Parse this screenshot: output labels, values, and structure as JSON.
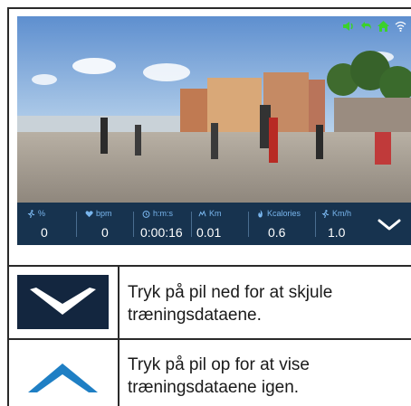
{
  "metrics": [
    {
      "icon": "runner-icon",
      "unit": "%",
      "value": "0"
    },
    {
      "icon": "heart-icon",
      "unit": "bpm",
      "value": "0"
    },
    {
      "icon": "clock-icon",
      "unit": "h:m:s",
      "value": "0:00:16"
    },
    {
      "icon": "distance-icon",
      "unit": "Km",
      "value": "0.01"
    },
    {
      "icon": "flame-icon",
      "unit": "Kcalories",
      "value": "0.6"
    },
    {
      "icon": "runner-icon",
      "unit": "Km/h",
      "value": "1.0"
    }
  ],
  "status_icons": [
    "speaker-icon",
    "back-icon",
    "home-icon",
    "wifi-icon"
  ],
  "rows": [
    {
      "icon": "chevron-down-icon",
      "text_line1": "Tryk på pil ned for at skjule",
      "text_line2": "træningsdataene."
    },
    {
      "icon": "chevron-up-icon",
      "text_line1": "Tryk på pil op for at vise",
      "text_line2": "træningsdataene igen."
    }
  ],
  "colors": {
    "databar": "#17334f",
    "metric_label": "#79b6ee",
    "status_green": "#3bd12b",
    "chevron_up": "#1f7fc4",
    "chevron_down_bg": "#13263f"
  }
}
